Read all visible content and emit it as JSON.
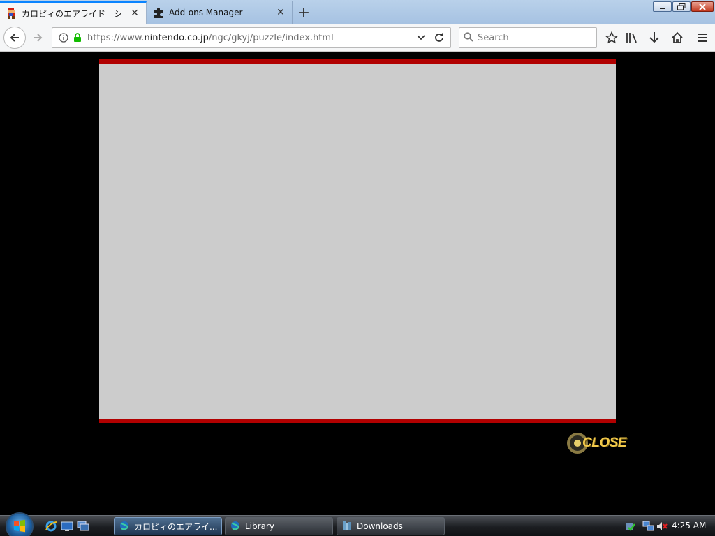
{
  "browser": {
    "tabs": [
      {
        "title": "カロピィのエアライド　シ",
        "icon": "mario-favicon",
        "active": true
      },
      {
        "title": "Add-ons Manager",
        "icon": "puzzle-piece-icon",
        "active": false
      }
    ],
    "url": {
      "prefix": "https://www.",
      "host": "nintendo.co.jp",
      "path": "/ngc/gkyj/puzzle/index.html"
    },
    "search": {
      "placeholder": "Search",
      "value": ""
    }
  },
  "page": {
    "frame_colors": {
      "background": "#cccccc",
      "border": "#b10000"
    },
    "close_label": "CLOSE"
  },
  "taskbar": {
    "buttons": [
      {
        "label": "カロピィのエアライ...",
        "icon": "firefox-icon",
        "active": true
      },
      {
        "label": "Library",
        "icon": "firefox-icon",
        "active": false
      },
      {
        "label": "Downloads",
        "icon": "folder-icon",
        "active": false
      }
    ],
    "clock": "4:25 AM"
  }
}
